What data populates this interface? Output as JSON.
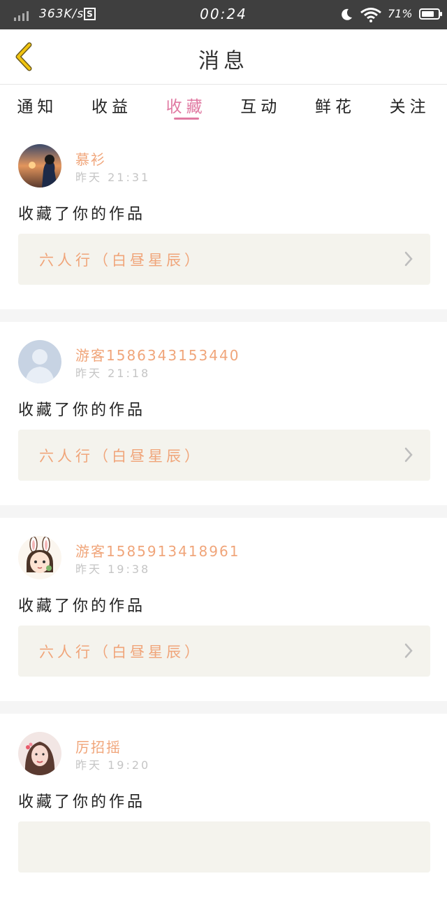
{
  "status_bar": {
    "speed": "363K/s",
    "s_icon": "S",
    "time": "00:24",
    "battery": "71%"
  },
  "header": {
    "title": "消息"
  },
  "tabs": [
    {
      "label": "通知"
    },
    {
      "label": "收益"
    },
    {
      "label": "收藏"
    },
    {
      "label": "互动"
    },
    {
      "label": "鲜花"
    },
    {
      "label": "关注"
    }
  ],
  "active_tab": "收藏",
  "feed": [
    {
      "username": "慕衫",
      "time": "昨天 21:31",
      "action": "收藏了你的作品",
      "work_title": "六人行（白昼星辰）",
      "avatar": "sunset-girl-avatar"
    },
    {
      "username": "游客1586343153440",
      "time": "昨天 21:18",
      "action": "收藏了你的作品",
      "work_title": "六人行（白昼星辰）",
      "avatar": "default-user-avatar"
    },
    {
      "username": "游客1585913418961",
      "time": "昨天 19:38",
      "action": "收藏了你的作品",
      "work_title": "六人行（白昼星辰）",
      "avatar": "bunny-girl-avatar"
    },
    {
      "username": "厉招摇",
      "time": "昨天 19:20",
      "action": "收藏了你的作品",
      "work_title": "",
      "avatar": "portrait-girl-avatar"
    }
  ],
  "colors": {
    "accent": "#e07aa2",
    "username": "#f0a57a",
    "work_box": "#f4f3ed",
    "status_bar": "#3f3f3f",
    "back_arrow": "#f1c40f"
  }
}
